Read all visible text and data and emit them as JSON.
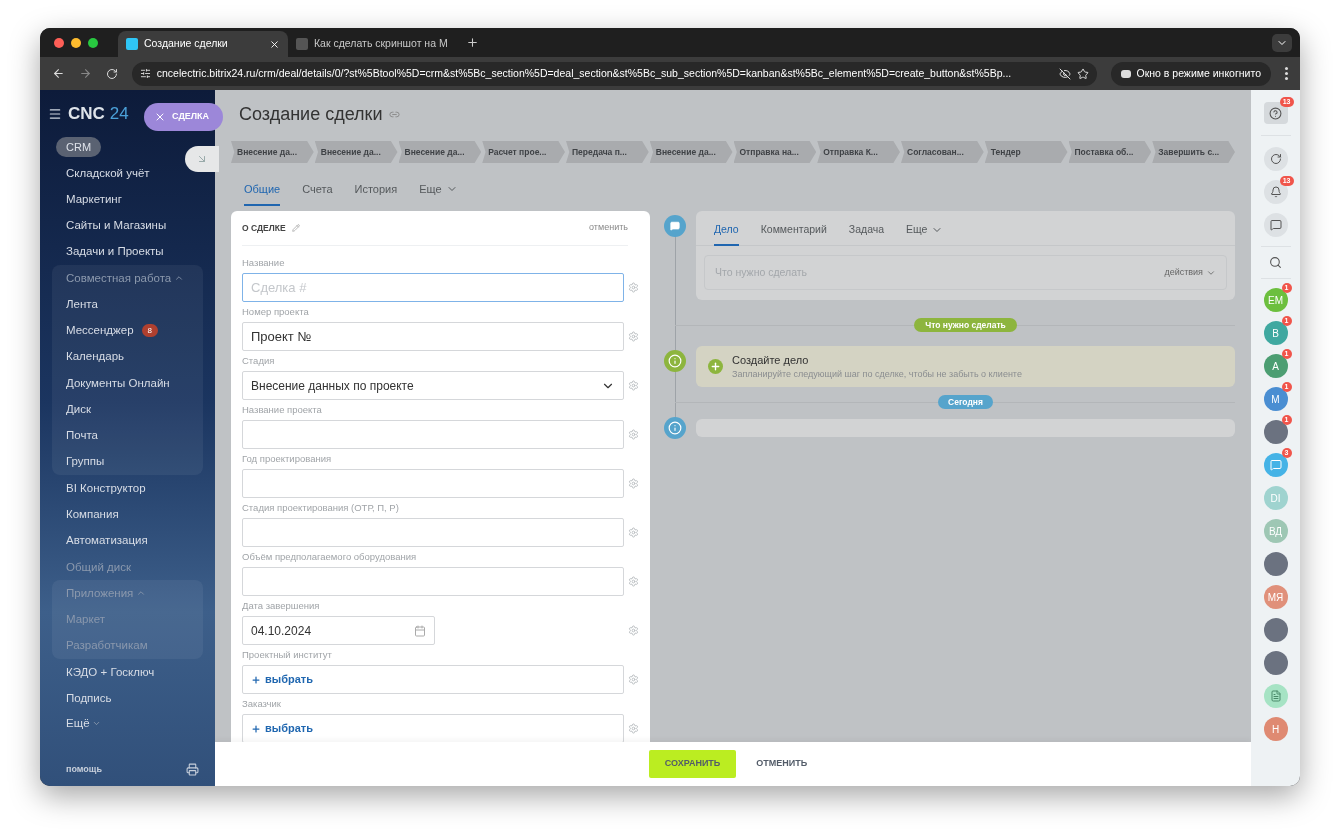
{
  "browser": {
    "tabs": [
      {
        "label": "Создание сделки",
        "selected": true
      },
      {
        "label": "Как сделать скриншот на М",
        "selected": false
      }
    ],
    "url": "cncelectric.bitrix24.ru/crm/deal/details/0/?st%5Btool%5D=crm&st%5Bc_section%5D=deal_section&st%5Bc_sub_section%5D=kanban&st%5Bc_element%5D=create_button&st%5Bp...",
    "incognito": "Окно в режиме инкогнито"
  },
  "sidebar": {
    "logo": "CNC",
    "logo_number": "24",
    "close_label": "СДЕЛКА",
    "items": [
      {
        "kind": "pill",
        "label": "CRM"
      },
      {
        "kind": "item",
        "label": "Складской учёт"
      },
      {
        "kind": "item",
        "label": "Маркетинг"
      },
      {
        "kind": "item",
        "label": "Сайты и Магазины"
      },
      {
        "kind": "item",
        "label": "Задачи и Проекты"
      },
      {
        "kind": "group",
        "label": "Совместная работа",
        "expanded": true,
        "children": [
          {
            "label": "Лента"
          },
          {
            "label": "Мессенджер",
            "badge": "8"
          },
          {
            "label": "Календарь"
          },
          {
            "label": "Документы Онлайн"
          },
          {
            "label": "Диск"
          },
          {
            "label": "Почта"
          },
          {
            "label": "Группы"
          }
        ]
      },
      {
        "kind": "item",
        "label": "BI Конструктор"
      },
      {
        "kind": "item",
        "label": "Компания"
      },
      {
        "kind": "item",
        "label": "Автоматизация"
      },
      {
        "kind": "item",
        "label": "Общий диск"
      },
      {
        "kind": "group",
        "label": "Приложения",
        "expanded": true,
        "children": [
          {
            "label": "Маркет"
          },
          {
            "label": "Разработчикам"
          }
        ]
      },
      {
        "kind": "item",
        "label": "КЭДО + Госключ"
      },
      {
        "kind": "item",
        "label": "Подпись"
      },
      {
        "kind": "more",
        "label": "Ещё"
      }
    ],
    "help": "помощь"
  },
  "page": {
    "title": "Создание сделки",
    "stages": [
      "Внесение да...",
      "Внесение да...",
      "Внесение да...",
      "Расчет прое...",
      "Передача п...",
      "Внесение да...",
      "Отправка на...",
      "Отправка К...",
      "Согласован...",
      "Тендер",
      "Поставка об...",
      "Завершить с..."
    ],
    "tabs": [
      {
        "label": "Общие",
        "selected": true,
        "dropdown": false
      },
      {
        "label": "Счета",
        "selected": false,
        "dropdown": false
      },
      {
        "label": "История",
        "selected": false,
        "dropdown": false
      },
      {
        "label": "Еще",
        "selected": false,
        "dropdown": true
      }
    ]
  },
  "form": {
    "title": "О СДЕЛКЕ",
    "cancel": "отменить",
    "fields": [
      {
        "kind": "text",
        "label": "Название",
        "placeholder": "Сделка #",
        "focused": true
      },
      {
        "kind": "text",
        "label": "Номер проекта",
        "value": "Проект №",
        "focused": false
      },
      {
        "kind": "select",
        "label": "Стадия",
        "value": "Внесение данных по проекте",
        "focused": false
      },
      {
        "kind": "text",
        "label": "Название проекта",
        "focused": false
      },
      {
        "kind": "text",
        "label": "Год проектирования",
        "focused": false
      },
      {
        "kind": "text",
        "label": "Стадия проектирования (ОТР, П, Р)",
        "focused": false
      },
      {
        "kind": "text",
        "label": "Объём предполагаемого оборудования",
        "focused": false
      },
      {
        "kind": "date",
        "label": "Дата завершения",
        "value": "04.10.2024",
        "focused": false
      },
      {
        "kind": "picker",
        "label": "Проектный институт",
        "value": "выбрать",
        "focused": false
      },
      {
        "kind": "picker",
        "label": "Заказчик",
        "value": "выбрать",
        "focused": false
      }
    ]
  },
  "timeline": {
    "tabs": [
      {
        "label": "Дело",
        "selected": true,
        "dropdown": false
      },
      {
        "label": "Комментарий",
        "selected": false,
        "dropdown": false
      },
      {
        "label": "Задача",
        "selected": false,
        "dropdown": false
      },
      {
        "label": "Еще",
        "selected": false,
        "dropdown": true
      }
    ],
    "placeholder": "Что нужно сделать",
    "actions": "действия",
    "todo_badge": "Что нужно сделать",
    "prompt_title": "Создайте дело",
    "prompt_text": "Запланируйте следующий шаг по сделке, чтобы не забыть о клиенте",
    "today_badge": "Сегодня"
  },
  "footer": {
    "save": "СОХРАНИТЬ",
    "cancel": "ОТМЕНИТЬ"
  },
  "rightbar": {
    "help_badge": "13",
    "bell_badge": "13",
    "contacts": [
      {
        "kind": "initials",
        "text": "ЕМ",
        "color": "#6cbf3e",
        "badge": "1"
      },
      {
        "kind": "initials",
        "text": "В",
        "color": "#3fa8a0",
        "badge": "1"
      },
      {
        "kind": "initials",
        "text": "А",
        "color": "#4c9e72",
        "badge": "1"
      },
      {
        "kind": "initials",
        "text": "М",
        "color": "#4a8ed2",
        "badge": "1"
      },
      {
        "kind": "photo",
        "badge": "1"
      },
      {
        "kind": "chat",
        "badge": "3"
      },
      {
        "kind": "initials",
        "text": "DI",
        "color": "#9fd3cf"
      },
      {
        "kind": "initials",
        "text": "ВД",
        "color": "#9ec7b4"
      },
      {
        "kind": "photo"
      },
      {
        "kind": "initials",
        "text": "МЯ",
        "color": "#e0907a"
      },
      {
        "kind": "photo"
      },
      {
        "kind": "photo"
      },
      {
        "kind": "document"
      },
      {
        "kind": "initials",
        "text": "Н",
        "color": "#df8a72"
      }
    ]
  }
}
